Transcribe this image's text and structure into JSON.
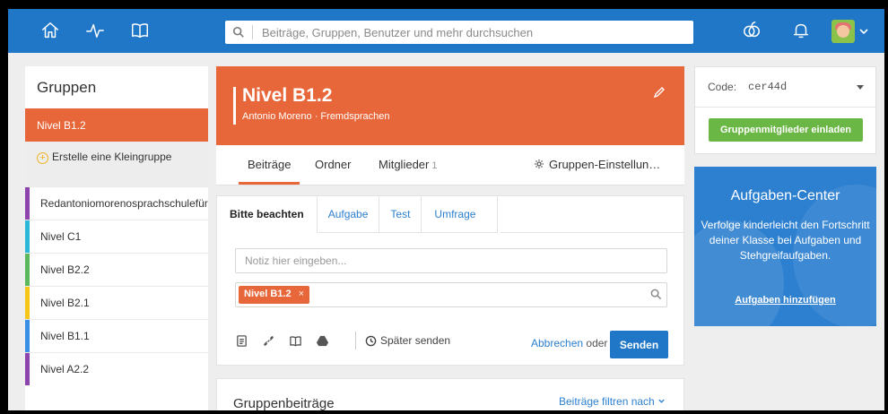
{
  "search": {
    "placeholder": "Beiträge, Gruppen, Benutzer und mehr durchsuchen"
  },
  "topbar": {
    "icons": [
      "home-icon",
      "activity-icon",
      "book-icon",
      "apple-icon",
      "bell-icon",
      "avatar",
      "chevron-down-icon"
    ]
  },
  "sidebar": {
    "title": "Gruppen",
    "active": "Nivel B1.2",
    "create_label": "Erstelle eine Kleingruppe",
    "items": [
      {
        "label": "Redantoniomorenosprachschulefür",
        "color": "#8e44ad"
      },
      {
        "label": "Nivel C1",
        "color": "#2bb8d8"
      },
      {
        "label": "Nivel B2.2",
        "color": "#5cb85c"
      },
      {
        "label": "Nivel B2.1",
        "color": "#f5c518"
      },
      {
        "label": "Nivel B1.1",
        "color": "#3a8ee6"
      },
      {
        "label": "Nivel A2.2",
        "color": "#8e44ad"
      }
    ]
  },
  "group": {
    "title": "Nivel B1.2",
    "subtitle": "Antonio Moreno · Fremdsprachen",
    "accent": "#e8673a"
  },
  "tabs": {
    "posts": "Beiträge",
    "folders": "Ordner",
    "members": "Mitglieder",
    "members_count": "1",
    "settings": "Gruppen-Einstellun…"
  },
  "composer": {
    "tabs": [
      "Bitte beachten",
      "Aufgabe",
      "Test",
      "Umfrage"
    ],
    "note_placeholder": "Notiz hier eingeben...",
    "chip_label": "Nivel B1.2",
    "chip_remove": "×",
    "later_label": "Später senden",
    "cancel_label": "Abbrechen",
    "or_label": "oder",
    "send_label": "Senden"
  },
  "posts": {
    "title": "Gruppenbeiträge",
    "filter_label": "Beiträge filtren nach"
  },
  "code": {
    "label": "Code:",
    "value": "cer44d",
    "invite_label": "Gruppenmitglieder einladen"
  },
  "task_center": {
    "title": "Aufgaben-Center",
    "text": "Verfolge kinderleicht den Fortschritt deiner Klasse bei Aufgaben und Stehgreifaufgaben.",
    "link": "Aufgaben hinzufügen"
  },
  "colors": {
    "primary": "#2077c7",
    "accent": "#e8673a",
    "green": "#6bb745"
  }
}
